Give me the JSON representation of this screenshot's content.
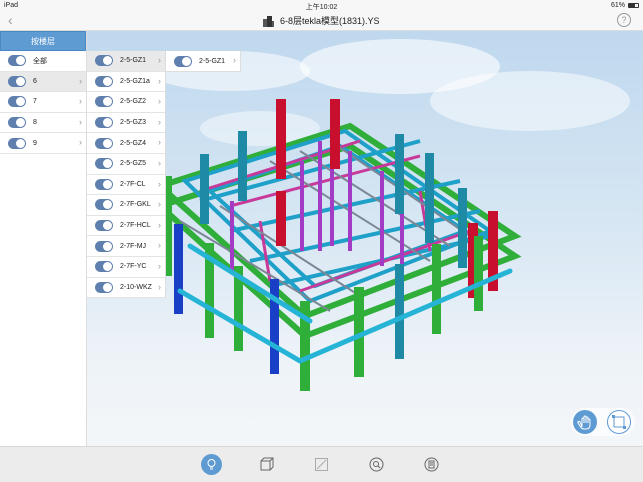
{
  "status": {
    "device": "iPad",
    "time": "上午10:02",
    "battery": "61%"
  },
  "nav": {
    "title": "6-8层tekla模型(1831).YS",
    "back_icon": "chevron-left-icon",
    "help_label": "?"
  },
  "floors": {
    "header": "按楼层",
    "items": [
      {
        "label": "全部",
        "on": true,
        "chevron": false
      },
      {
        "label": "6",
        "on": true,
        "chevron": true,
        "selected": true
      },
      {
        "label": "7",
        "on": true,
        "chevron": true
      },
      {
        "label": "8",
        "on": true,
        "chevron": true
      },
      {
        "label": "9",
        "on": true,
        "chevron": true
      }
    ]
  },
  "groups": {
    "items": [
      {
        "label": "2-5-GZ1",
        "selected": true
      },
      {
        "label": "2-5-GZ1a"
      },
      {
        "label": "2-5-GZ2"
      },
      {
        "label": "2-5-GZ3"
      },
      {
        "label": "2-5-GZ4"
      },
      {
        "label": "2-5-GZ5"
      },
      {
        "label": "2-7F-CL"
      },
      {
        "label": "2-7F-GKL"
      },
      {
        "label": "2-7F-HCL"
      },
      {
        "label": "2-7F-MJ"
      },
      {
        "label": "2-7F-YC"
      },
      {
        "label": "2-10-WKZ"
      }
    ]
  },
  "components": {
    "items": [
      {
        "label": "2-5-GZ1"
      }
    ]
  },
  "colors": {
    "accent": "#5f9bd3",
    "toggle": "#5f7fae",
    "red": "#c8102e",
    "teal": "#1e8aa6",
    "green": "#2fae3a",
    "purple": "#a33cc4",
    "blue": "#1a3fc7",
    "cyan": "#26b4d6"
  },
  "toolbar": {
    "buttons": [
      "lightbulb-icon",
      "cube-icon",
      "box-select-icon",
      "search-icon",
      "clipboard-icon"
    ]
  },
  "fab": {
    "buttons": [
      "hand-icon",
      "select-box-icon"
    ]
  }
}
